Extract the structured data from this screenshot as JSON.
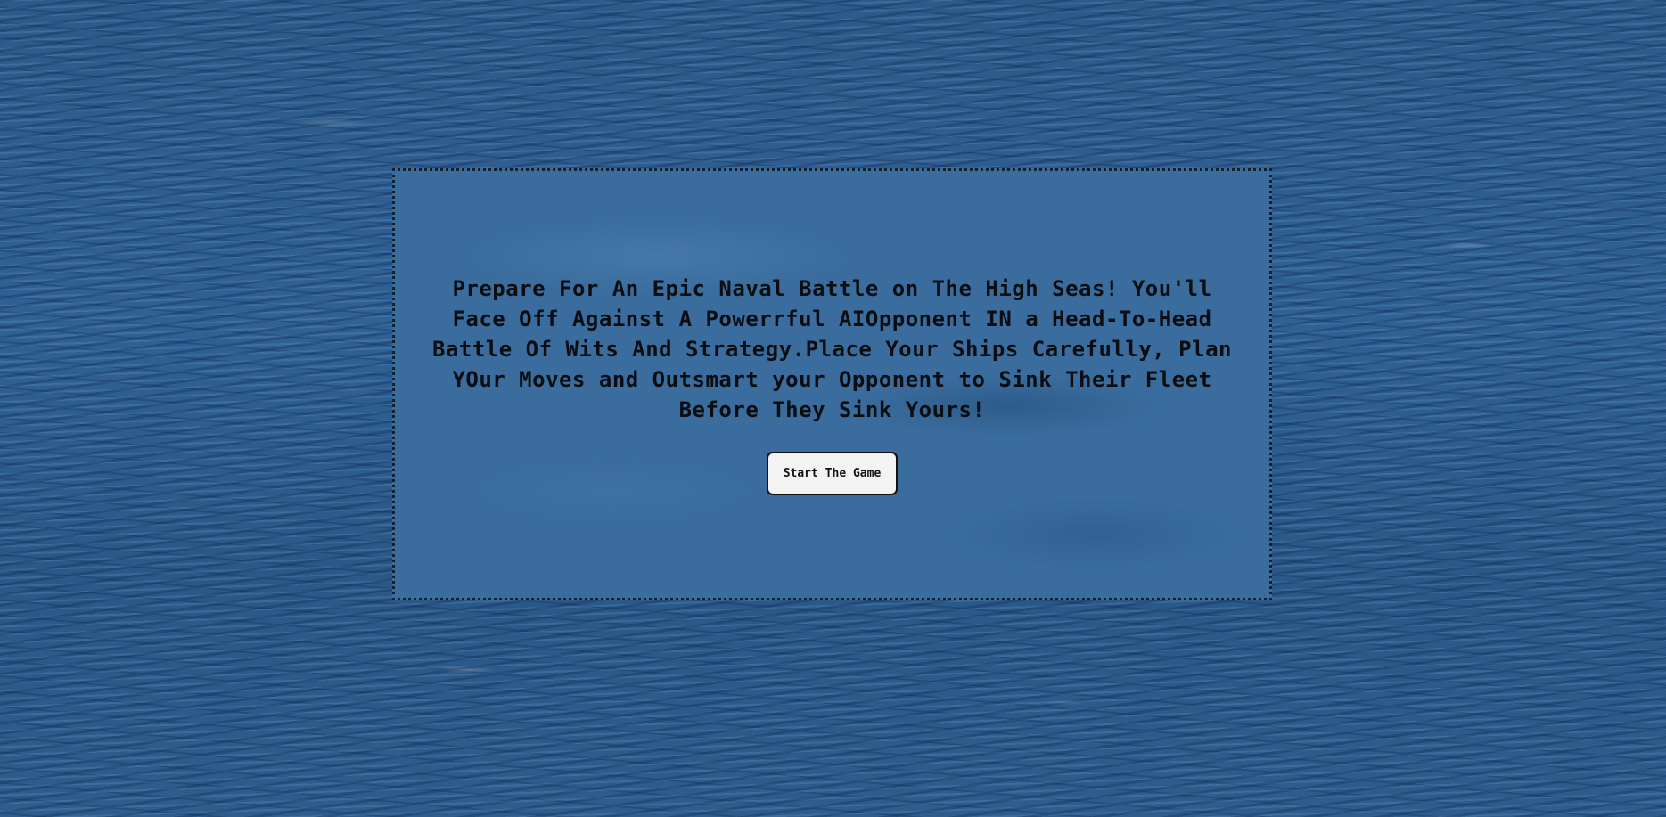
{
  "intro": {
    "text": "Prepare For An Epic Naval Battle on The High Seas! You'll Face Off Against A Powerrful AIOpponent IN a Head-To-Head Battle Of Wits And Strategy.Place Your Ships Carefully, Plan YOur Moves and Outsmart your Opponent to Sink Their Fleet Before They Sink Yours!"
  },
  "start_button": {
    "label": "Start The Game"
  },
  "colors": {
    "ocean": "#2f5f8f",
    "panel": "#3a6d9e",
    "panel_border": "#14202e",
    "text": "#0b0d10",
    "button_bg": "#f3f3f3"
  }
}
